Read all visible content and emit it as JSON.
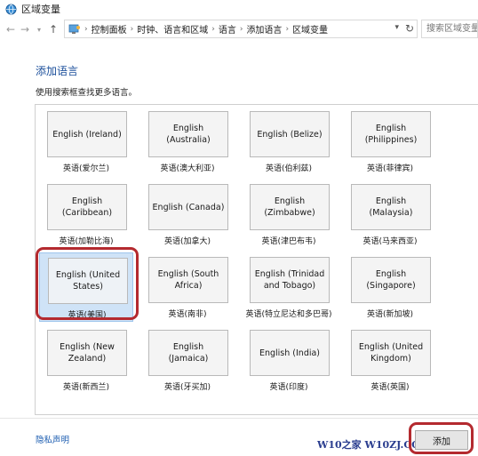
{
  "window": {
    "title": "区域变量",
    "icon": "region-globe-icon"
  },
  "nav": {
    "back_icon": "arrow-left-icon",
    "forward_icon": "arrow-right-icon",
    "recent_icon": "chevron-down-icon",
    "up_icon": "arrow-up-icon",
    "breadcrumb": [
      "控制面板",
      "时钟、语言和区域",
      "语言",
      "添加语言",
      "区域变量"
    ],
    "search_placeholder": "搜索区域变量"
  },
  "page": {
    "title": "添加语言",
    "subtitle": "使用搜索框查找更多语言。"
  },
  "languages": [
    {
      "tile": "English (Ireland)",
      "label": "英语(爱尔兰)",
      "selected": false
    },
    {
      "tile": "English (Australia)",
      "label": "英语(澳大利亚)",
      "selected": false
    },
    {
      "tile": "English (Belize)",
      "label": "英语(伯利兹)",
      "selected": false
    },
    {
      "tile": "English (Philippines)",
      "label": "英语(菲律宾)",
      "selected": false
    },
    {
      "tile": "English (Caribbean)",
      "label": "英语(加勒比海)",
      "selected": false
    },
    {
      "tile": "English (Canada)",
      "label": "英语(加拿大)",
      "selected": false
    },
    {
      "tile": "English (Zimbabwe)",
      "label": "英语(津巴布韦)",
      "selected": false
    },
    {
      "tile": "English (Malaysia)",
      "label": "英语(马来西亚)",
      "selected": false
    },
    {
      "tile": "English (United States)",
      "label": "英语(美国)",
      "selected": true
    },
    {
      "tile": "English (South Africa)",
      "label": "英语(南非)",
      "selected": false
    },
    {
      "tile": "English (Trinidad and Tobago)",
      "label": "英语(特立尼达和多巴哥)",
      "selected": false
    },
    {
      "tile": "English (Singapore)",
      "label": "英语(新加坡)",
      "selected": false
    },
    {
      "tile": "English (New Zealand)",
      "label": "英语(新西兰)",
      "selected": false
    },
    {
      "tile": "English (Jamaica)",
      "label": "英语(牙买加)",
      "selected": false
    },
    {
      "tile": "English (India)",
      "label": "英语(印度)",
      "selected": false
    },
    {
      "tile": "English (United Kingdom)",
      "label": "英语(英国)",
      "selected": false
    }
  ],
  "footer": {
    "privacy_link": "隐私声明",
    "add_button": "添加",
    "watermark": "W10之家 W10ZJ.COM"
  },
  "colors": {
    "highlight": "#b42a2f",
    "selected_bg": "#cfe3f7",
    "link": "#1b5cb0"
  }
}
